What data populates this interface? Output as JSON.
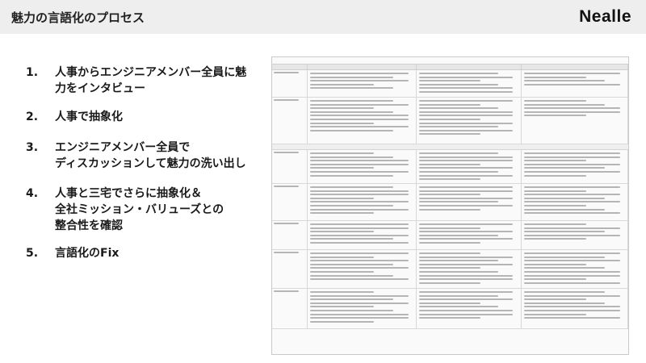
{
  "header": {
    "title": "魅力の言語化のプロセス",
    "brand": "Nealle"
  },
  "steps": [
    {
      "num": "1.",
      "text": "人事からエンジニアメンバー全員に魅\n力をインタビュー"
    },
    {
      "num": "2.",
      "text": "人事で抽象化"
    },
    {
      "num": "3.",
      "text": "エンジニアメンバー全員で\nディスカッションして魅力の洗い出し"
    },
    {
      "num": "4.",
      "text": "人事と三宅でさらに抽象化＆\n全社ミッション・バリューズとの\n整合性を確認"
    },
    {
      "num": "5.",
      "text": "言語化のFix"
    }
  ]
}
